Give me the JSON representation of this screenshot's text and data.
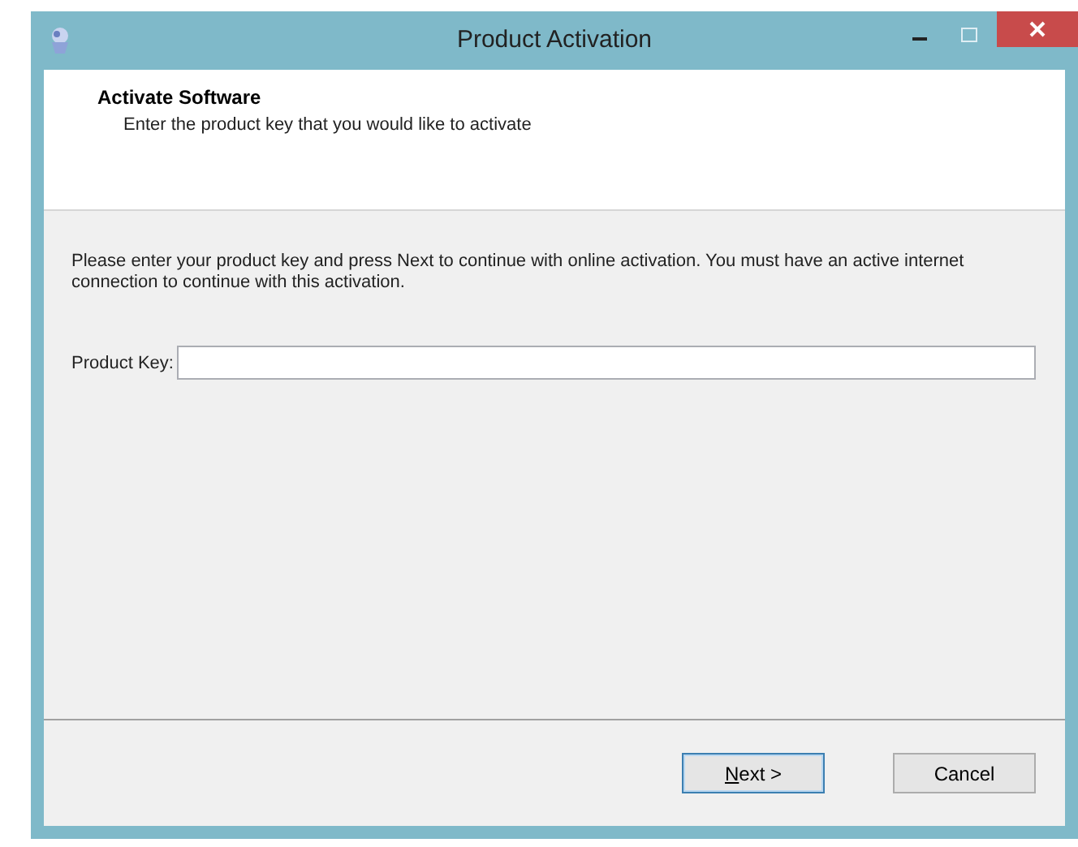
{
  "window": {
    "title": "Product Activation"
  },
  "header": {
    "title": "Activate Software",
    "subtitle": "Enter the product key that you would like to activate"
  },
  "instructions": "Please enter your product key and press Next to continue with online activation. You must have an active internet connection to continue with this activation.",
  "product_key": {
    "label": "Product Key:"
  },
  "buttons": [
    {
      "label": "Next >",
      "default": true
    },
    {
      "label": "Cancel",
      "default": false
    }
  ]
}
